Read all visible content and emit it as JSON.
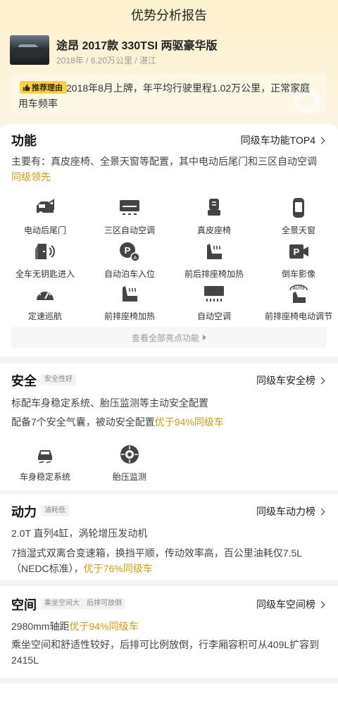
{
  "header": {
    "title": "优势分析报告"
  },
  "car": {
    "name": "途昂 2017款 330TSI 两驱豪华版",
    "meta": "2018年 / 6.20万公里 / 湛江"
  },
  "reason": {
    "badge": "推荐理由",
    "text": "2018年8月上牌，年平均行驶里程1.02万公里，正常家庭用车频率"
  },
  "features": {
    "title": "功能",
    "link": "同级车功能TOP4",
    "desc_main": "主要有：真皮座椅、全景天窗等配置，其中电动后尾门和三区自动空调",
    "desc_hl": "同级领先",
    "items": [
      {
        "label": "电动后尾门",
        "icon": "tailgate-icon"
      },
      {
        "label": "三区自动空调",
        "icon": "climate-icon"
      },
      {
        "label": "真皮座椅",
        "icon": "leather-seat-icon"
      },
      {
        "label": "全景天窗",
        "icon": "sunroof-icon"
      },
      {
        "label": "全车无钥匙进入",
        "icon": "keyless-entry-icon"
      },
      {
        "label": "自动泊车入位",
        "icon": "auto-park-icon"
      },
      {
        "label": "前后排座椅加热",
        "icon": "seat-heating-icon"
      },
      {
        "label": "倒车影像",
        "icon": "reverse-camera-icon"
      },
      {
        "label": "定速巡航",
        "icon": "cruise-control-icon"
      },
      {
        "label": "前排座椅加热",
        "icon": "front-seat-heating-icon"
      },
      {
        "label": "自动空调",
        "icon": "auto-ac-icon"
      },
      {
        "label": "前排座椅电动调节",
        "icon": "power-seat-icon"
      }
    ],
    "more": "查看全部亮点功能"
  },
  "safety": {
    "title": "安全",
    "tag": "安全性好",
    "link": "同级车安全榜",
    "line1": "标配车身稳定系统、胎压监测等主动安全配置",
    "line2_main": "配备7个安全气囊，被动安全配置",
    "line2_hl": "优于94%同级车",
    "items": [
      {
        "label": "车身稳定系统",
        "icon": "stability-control-icon"
      },
      {
        "label": "胎压监测",
        "icon": "tire-pressure-icon"
      }
    ]
  },
  "power": {
    "title": "动力",
    "tag": "油耗低",
    "link": "同级车动力榜",
    "line1": "2.0T 直列4缸，涡轮增压发动机",
    "line2_main": "7挡湿式双离合变速箱，换挡平顺，传动效率高，百公里油耗仅7.5L（NEDC标准），",
    "line2_hl": "优于76%同级车"
  },
  "space": {
    "title": "空间",
    "tag1": "乘坐空间大",
    "tag2": "后排可放倒",
    "link": "同级车空间榜",
    "line1_main": "2980mm轴距",
    "line1_hl": "优于94%同级车",
    "line2": "乘坐空间和舒适性较好，后排可比例放倒，行李厢容积可从409L扩容到2415L"
  },
  "colors": {
    "highlight": "#d09a13",
    "badge": "#f7cf4d"
  }
}
